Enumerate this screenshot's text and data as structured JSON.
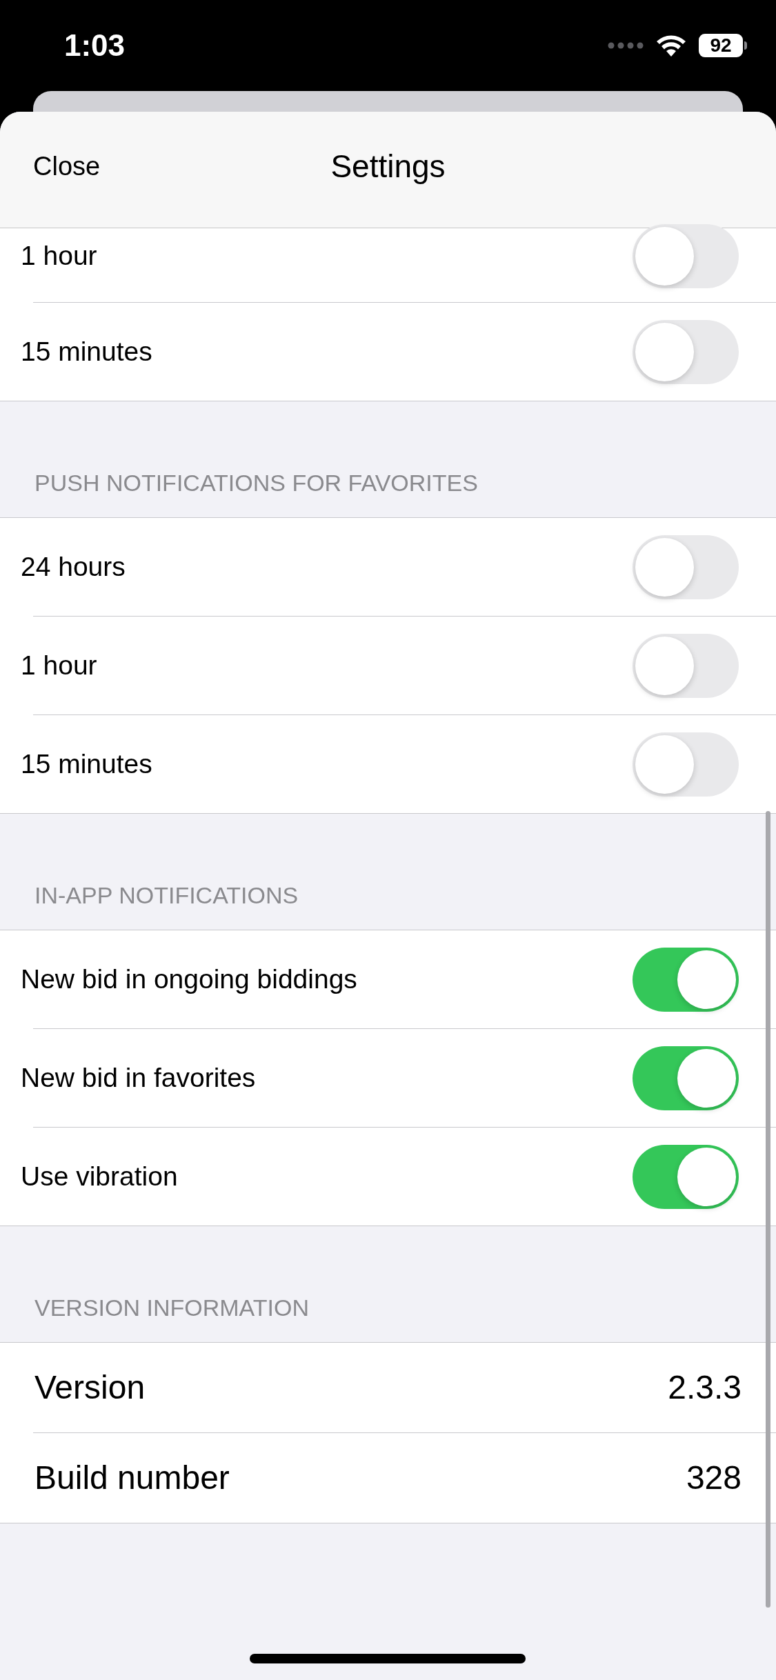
{
  "status_bar": {
    "time": "1:03",
    "battery": "92"
  },
  "header": {
    "close": "Close",
    "title": "Settings"
  },
  "sections": [
    {
      "rows": [
        {
          "label": "1 hour",
          "on": false
        },
        {
          "label": "15 minutes",
          "on": false
        }
      ]
    },
    {
      "title": "PUSH NOTIFICATIONS FOR FAVORITES",
      "rows": [
        {
          "label": "24 hours",
          "on": false
        },
        {
          "label": "1 hour",
          "on": false
        },
        {
          "label": "15 minutes",
          "on": false
        }
      ]
    },
    {
      "title": "IN-APP NOTIFICATIONS",
      "rows": [
        {
          "label": "New bid in ongoing biddings",
          "on": true
        },
        {
          "label": "New bid in favorites",
          "on": true
        },
        {
          "label": "Use vibration",
          "on": true
        }
      ]
    },
    {
      "title": "VERSION INFORMATION",
      "info": [
        {
          "label": "Version",
          "value": "2.3.3"
        },
        {
          "label": "Build number",
          "value": "328"
        }
      ]
    }
  ]
}
